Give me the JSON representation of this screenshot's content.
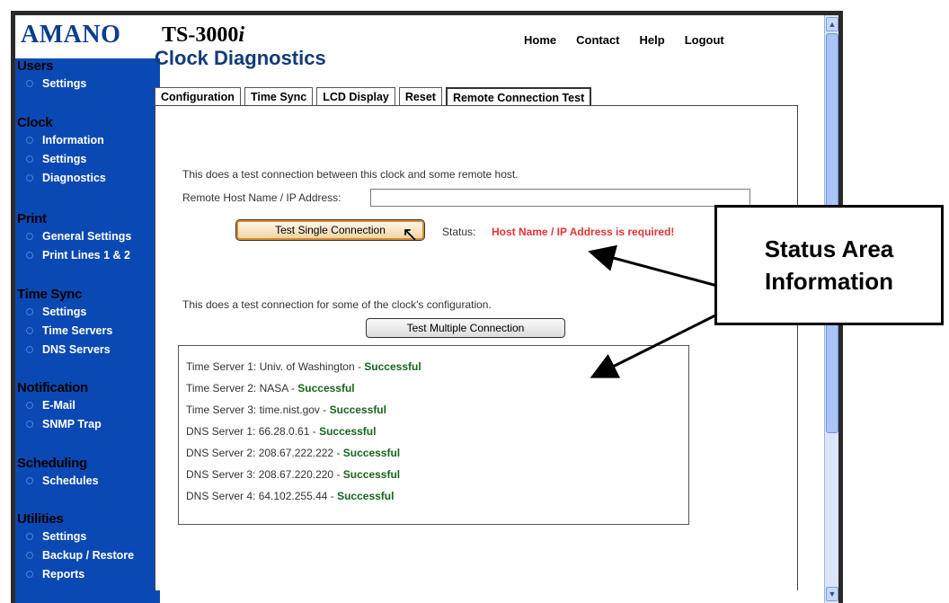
{
  "header": {
    "brand": "AMANO",
    "model": "TS-3000",
    "model_suffix": "i",
    "nav": [
      "Home",
      "Contact",
      "Help",
      "Logout"
    ]
  },
  "sidebar": {
    "groups": [
      {
        "title": "Users",
        "items": [
          "Settings"
        ]
      },
      {
        "title": "Clock",
        "items": [
          "Information",
          "Settings",
          "Diagnostics"
        ]
      },
      {
        "title": "Print",
        "items": [
          "General Settings",
          "Print Lines 1 & 2"
        ]
      },
      {
        "title": "Time Sync",
        "items": [
          "Settings",
          "Time Servers",
          "DNS Servers"
        ]
      },
      {
        "title": "Notification",
        "items": [
          "E-Mail",
          "SNMP Trap"
        ]
      },
      {
        "title": "Scheduling",
        "items": [
          "Schedules"
        ]
      },
      {
        "title": "Utilities",
        "items": [
          "Settings",
          "Backup / Restore",
          "Reports"
        ]
      }
    ]
  },
  "main": {
    "title": "Clock Diagnostics",
    "tabs": [
      "Configuration",
      "Time Sync",
      "LCD Display",
      "Reset",
      "Remote Connection Test"
    ],
    "active_tab": "Remote Connection Test",
    "single": {
      "description": "This does a test connection between this clock and some remote host.",
      "host_label": "Remote Host Name / IP Address:",
      "host_value": "",
      "button": "Test Single Connection",
      "status_label": "Status:",
      "status_value": "Host Name / IP Address is required!"
    },
    "multiple": {
      "description": "This does a test connection for some of the clock's configuration.",
      "button": "Test Multiple Connection"
    },
    "results": [
      {
        "label": "Time Server 1: Univ. of Washington - ",
        "status": "Successful"
      },
      {
        "label": "Time Server 2: NASA - ",
        "status": "Successful"
      },
      {
        "label": "Time Server 3: time.nist.gov - ",
        "status": "Successful"
      },
      {
        "label": "DNS Server 1: 66.28.0.61 - ",
        "status": "Successful"
      },
      {
        "label": "DNS Server 2: 208.67.222.222 - ",
        "status": "Successful"
      },
      {
        "label": "DNS Server 3: 208.67.220.220 - ",
        "status": "Successful"
      },
      {
        "label": "DNS Server 4: 64.102.255.44 - ",
        "status": "Successful"
      }
    ]
  },
  "annotation": {
    "line1": "Status Area",
    "line2": "Information"
  },
  "colors": {
    "sidebar_bg": "#0a49b3",
    "brand": "#0a3d8f",
    "status_error": "#e53333",
    "success": "#17651b"
  }
}
